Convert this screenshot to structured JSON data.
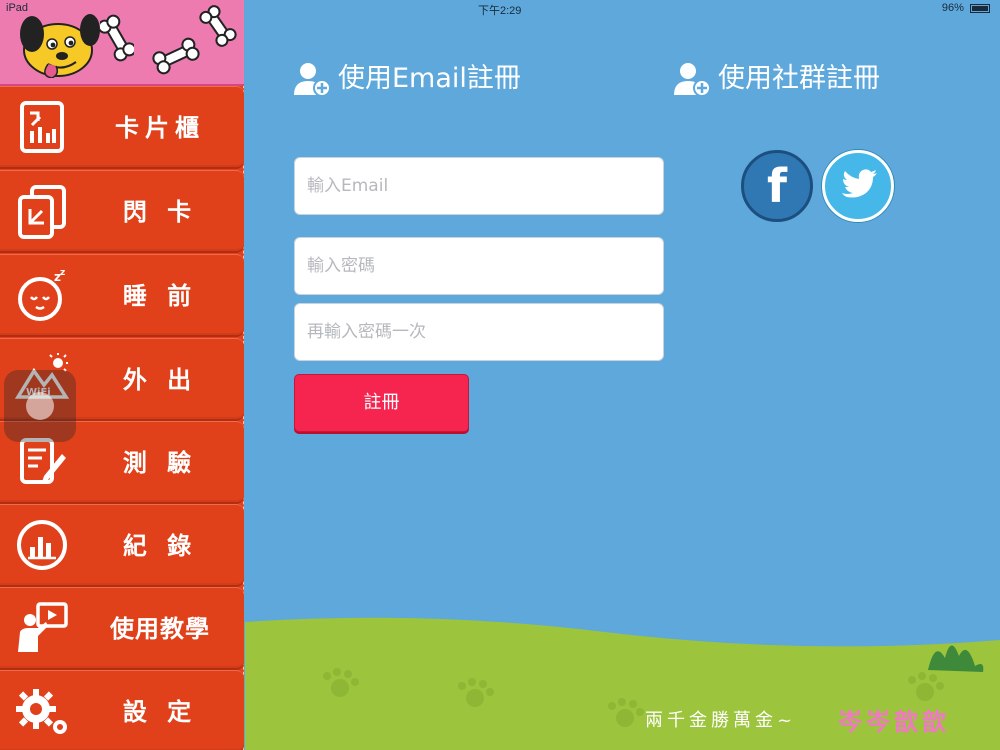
{
  "status_bar": {
    "device": "iPad",
    "time": "下午2:29",
    "battery": "96%"
  },
  "sidebar": {
    "items": [
      {
        "label": "卡片櫃",
        "icon": "card-cabinet-icon"
      },
      {
        "label": "閃 卡",
        "icon": "flash-card-icon"
      },
      {
        "label": "睡 前",
        "icon": "sleeping-face-icon"
      },
      {
        "label": "外 出",
        "icon": "outdoor-wifi-mountain-icon"
      },
      {
        "label": "測 驗",
        "icon": "quiz-pencil-icon"
      },
      {
        "label": "紀 錄",
        "icon": "record-chart-icon"
      },
      {
        "label": "使用教學",
        "icon": "tutorial-presenter-icon"
      },
      {
        "label": "設 定",
        "icon": "gear-icon"
      }
    ]
  },
  "email_section": {
    "title": "使用Email註冊",
    "email_placeholder": "輸入Email",
    "password_placeholder": "輸入密碼",
    "confirm_placeholder": "再輸入密碼一次",
    "register_label": "註冊"
  },
  "social_section": {
    "title": "使用社群註冊",
    "facebook_glyph": "f"
  },
  "footer": {
    "text": "兩千金勝萬金~",
    "accent": "岑岑歆歆"
  },
  "colors": {
    "background": "#5ea8dc",
    "sidebar": "#e0411b",
    "sidebar_header": "#ee7bb0",
    "register_button": "#f5254f",
    "facebook": "#2f78b4",
    "twitter": "#46b7e9",
    "grass": "#9cc43c"
  }
}
